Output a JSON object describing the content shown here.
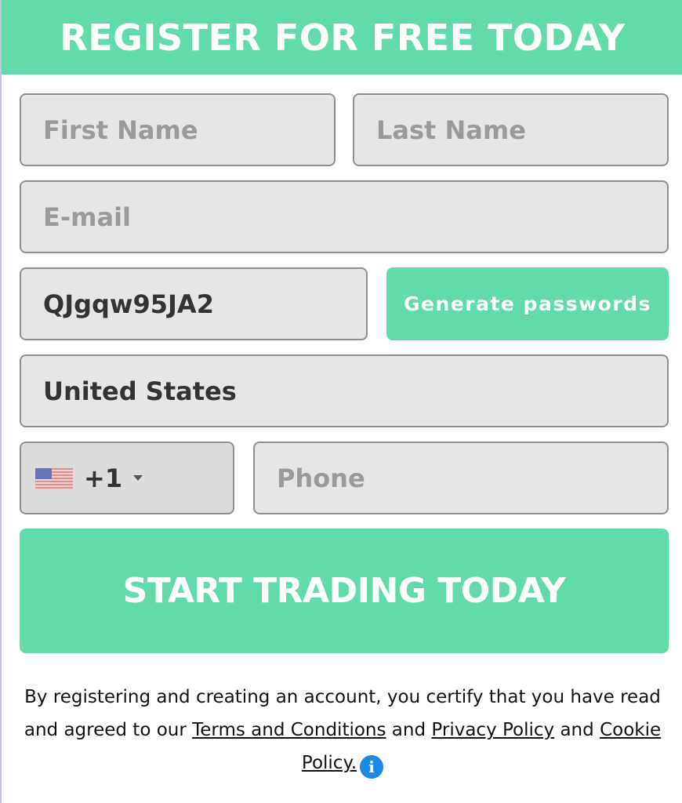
{
  "header": {
    "title": "REGISTER FOR FREE TODAY"
  },
  "form": {
    "first_name": {
      "placeholder": "First Name",
      "value": ""
    },
    "last_name": {
      "placeholder": "Last Name",
      "value": ""
    },
    "email": {
      "placeholder": "E-mail",
      "value": ""
    },
    "password": {
      "value": "QJgqw95JA2"
    },
    "generate_button": "Generate passwords",
    "country": "United States",
    "dial_code": "+1",
    "flag_icon": "us-flag-icon",
    "phone": {
      "placeholder": "Phone",
      "value": ""
    },
    "submit_button": "START TRADING TODAY"
  },
  "legal": {
    "text_1": "By registering and creating an account, you certify that you have read and agreed to our ",
    "terms_link": "Terms and Conditions",
    "and_1": " and ",
    "privacy_link": "Privacy Policy",
    "and_2": " and ",
    "cookie_link": "Cookie Policy",
    "period": ".",
    "info_icon": "i"
  },
  "colors": {
    "accent": "#60dba9",
    "field_bg": "#e6e6e6",
    "info_blue": "#1e88e5"
  }
}
